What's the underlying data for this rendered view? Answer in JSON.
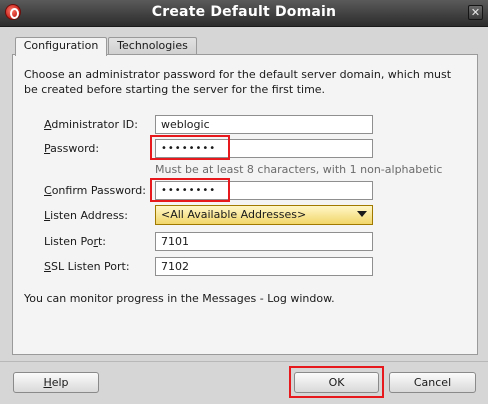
{
  "window": {
    "title": "Create Default Domain",
    "close_glyph": "✕"
  },
  "tabs": [
    {
      "label": "Configuration",
      "active": true
    },
    {
      "label": "Technologies",
      "active": false
    }
  ],
  "description": "Choose an administrator password for the default server domain, which must be created before starting the server for the first time.",
  "form": {
    "admin_id": {
      "label_mnemonic": "A",
      "label_rest": "dministrator ID:",
      "value": "weblogic"
    },
    "password": {
      "label_mnemonic": "P",
      "label_rest": "assword:",
      "value": "••••••••"
    },
    "password_hint": "Must be at least 8 characters, with 1 non-alphabetic",
    "confirm_password": {
      "label_mnemonic": "C",
      "label_rest": "onfirm Password:",
      "value": "••••••••"
    },
    "listen_address": {
      "label_mnemonic": "L",
      "label_rest": "isten Address:",
      "value": "<All Available Addresses>"
    },
    "listen_port": {
      "label_before": "Listen Po",
      "label_mnemonic": "r",
      "label_after": "t:",
      "value": "7101"
    },
    "ssl_listen_port": {
      "label_mnemonic": "S",
      "label_rest": "SL Listen Port:",
      "value": "7102"
    }
  },
  "note": "You can monitor progress in the Messages - Log window.",
  "buttons": {
    "help": {
      "mnemonic": "H",
      "rest": "elp"
    },
    "ok": "OK",
    "cancel": "Cancel"
  },
  "colors": {
    "highlight": "#e8191c",
    "select_bg": "#f2d66a"
  },
  "icons": {
    "app": "oracle-logo-icon",
    "close": "close-icon",
    "dropdown": "chevron-down-icon"
  }
}
